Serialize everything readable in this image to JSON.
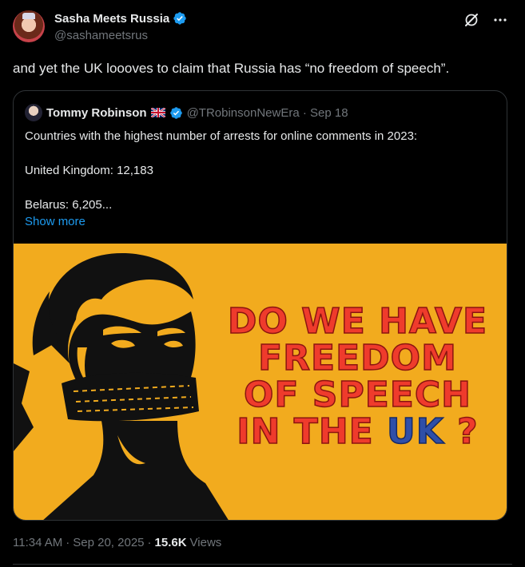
{
  "author": {
    "display_name": "Sasha Meets Russia",
    "handle": "@sashameetsrus",
    "verified": true
  },
  "tweet_text": "and yet the UK loooves to claim that Russia has “no freedom of speech”.",
  "quoted": {
    "display_name": "Tommy Robinson",
    "flag": "uk-flag",
    "handle_and_date": "@TRobinsonNewEra · Sep 18",
    "lines": {
      "l1": "Countries with the highest number of arrests for online comments in 2023:",
      "l2": "United Kingdom: 12,183",
      "l3": "Belarus: 6,205..."
    },
    "show_more": "Show more",
    "media": {
      "line1": "DO WE HAVE",
      "line2": "FREEDOM",
      "line3": "OF SPEECH",
      "line4_prefix": "IN THE ",
      "line4_uk": "UK",
      "line4_suffix": " ?",
      "background": "#f2ab1e",
      "text_color": "#ef3b2c",
      "uk_color": "#2f4fa8"
    }
  },
  "meta": {
    "time": "11:34 AM",
    "sep1": "·",
    "date": "Sep 20, 2025",
    "sep2": "·",
    "views_count": "15.6K",
    "views_label": "Views"
  },
  "colors": {
    "accent": "#1d9bf0",
    "muted": "#71767b",
    "text": "#e7e9ea",
    "border": "#2f3336"
  }
}
